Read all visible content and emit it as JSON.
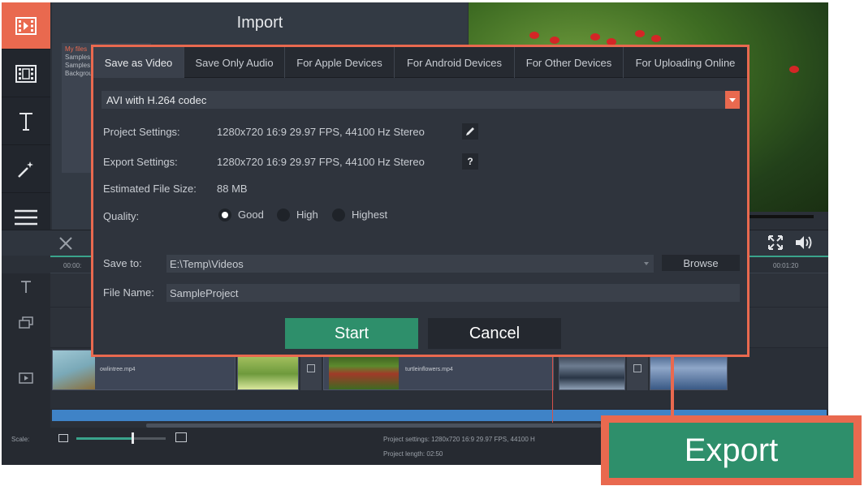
{
  "import_panel": {
    "title": "Import",
    "media_items": [
      "My files",
      "Samples",
      "Samples",
      "Backgrounds"
    ]
  },
  "toolbar": {
    "tools": [
      {
        "icon": "import-icon",
        "active": true
      },
      {
        "icon": "clip-icon",
        "active": false
      },
      {
        "icon": "titles-icon",
        "active": false
      },
      {
        "icon": "magic-wand-icon",
        "active": false
      },
      {
        "icon": "menu-icon",
        "active": false
      }
    ]
  },
  "timeline": {
    "ruler_times": [
      "00:00:",
      "00:01:20"
    ],
    "clips": [
      {
        "label": "owlintree.mp4"
      },
      {
        "label": "turtleinflowers.mp4"
      }
    ]
  },
  "statusbar": {
    "scale_label": "Scale:",
    "scale_level": 0.64,
    "project_settings": "Project settings:  1280x720 16:9 29.97 FPS, 44100 H",
    "project_length": "Project length:    02:50"
  },
  "dialog": {
    "tabs": [
      {
        "label": "Save as Video",
        "active": true
      },
      {
        "label": "Save Only Audio",
        "active": false
      },
      {
        "label": "For Apple Devices",
        "active": false
      },
      {
        "label": "For Android Devices",
        "active": false
      },
      {
        "label": "For Other Devices",
        "active": false
      },
      {
        "label": "For Uploading Online",
        "active": false
      }
    ],
    "format": "AVI with H.264 codec",
    "project_settings_label": "Project Settings:",
    "project_settings_value": "1280x720 16:9 29.97 FPS, 44100 Hz Stereo",
    "export_settings_label": "Export Settings:",
    "export_settings_value": "1280x720 16:9 29.97 FPS, 44100 Hz Stereo",
    "help_label": "?",
    "file_size_label": "Estimated File Size:",
    "file_size_value": "88 MB",
    "quality_label": "Quality:",
    "quality_options": [
      "Good",
      "High",
      "Highest"
    ],
    "quality_selected": "Good",
    "save_to_label": "Save to:",
    "save_to_value": "E:\\Temp\\Videos",
    "browse_label": "Browse",
    "file_name_label": "File Name:",
    "file_name_value": "SampleProject",
    "start_label": "Start",
    "cancel_label": "Cancel"
  },
  "export_callout": {
    "label": "Export"
  },
  "colors": {
    "accent": "#e9694f",
    "green_button": "#2e8f6b",
    "timeline_teal": "#3aa38b",
    "audio_track": "#3f83c7",
    "panel": "#2f343d"
  }
}
